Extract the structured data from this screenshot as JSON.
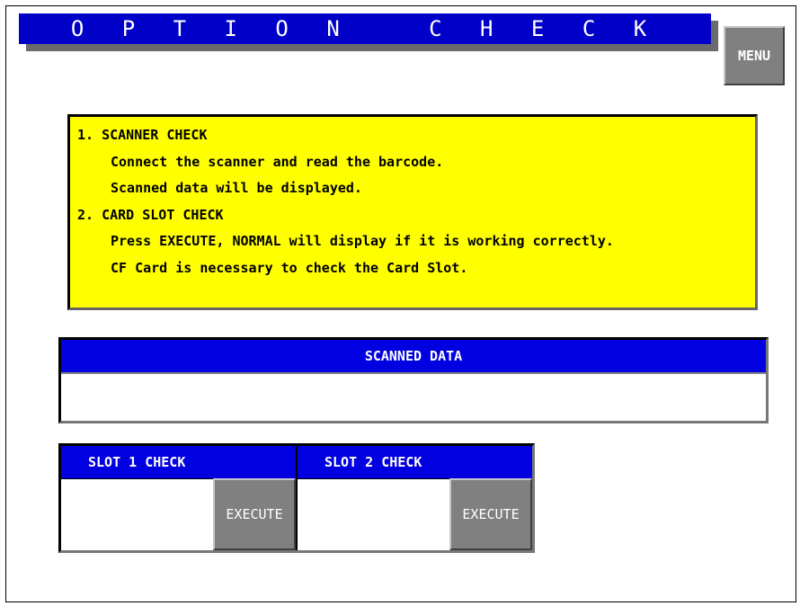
{
  "header": {
    "title": "O P T I O N   C H E C K"
  },
  "menu": {
    "label": "MENU"
  },
  "instructions": [
    {
      "text": "1. SCANNER CHECK",
      "indent": false
    },
    {
      "text": "Connect the scanner and read the barcode.",
      "indent": true
    },
    {
      "text": "Scanned data will be displayed.",
      "indent": true
    },
    {
      "text": "2. CARD SLOT CHECK",
      "indent": false
    },
    {
      "text": "Press EXECUTE, NORMAL will display if it is working correctly.",
      "indent": true
    },
    {
      "text": "CF Card is necessary to check the Card Slot.",
      "indent": true
    }
  ],
  "scanned": {
    "header": "SCANNED DATA",
    "value": ""
  },
  "slots": [
    {
      "header": "SLOT 1 CHECK",
      "value": "",
      "button": "EXECUTE"
    },
    {
      "header": "SLOT 2 CHECK",
      "value": "",
      "button": "EXECUTE"
    }
  ],
  "colors": {
    "title_bg": "#0000c8",
    "panel_bg": "#ffff00",
    "button_bg": "#808080"
  }
}
